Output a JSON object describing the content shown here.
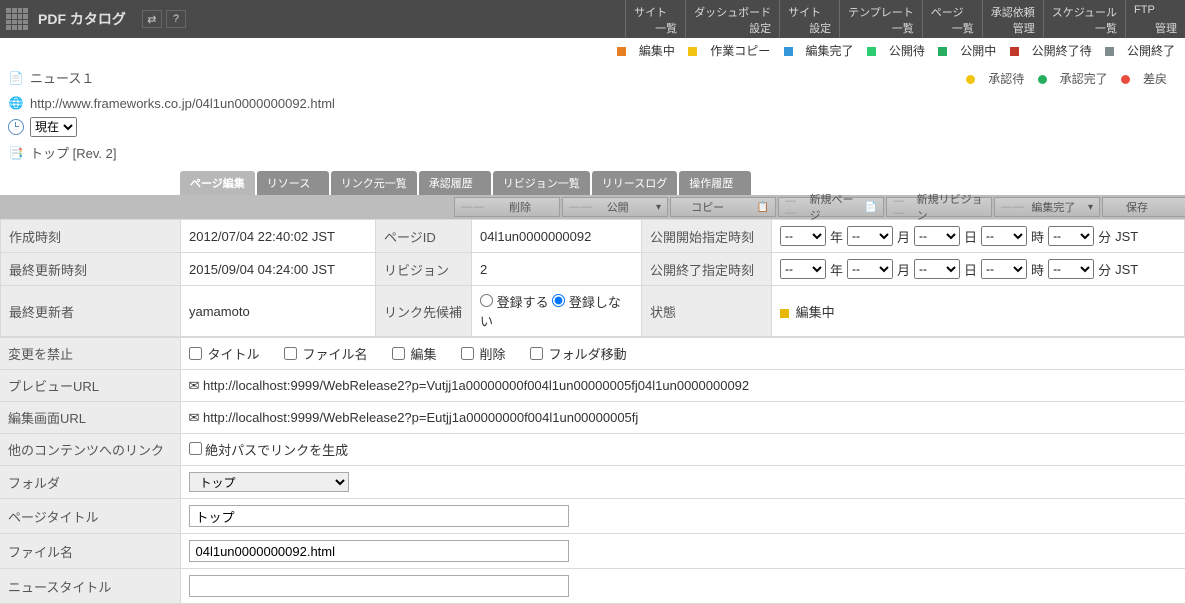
{
  "topbar": {
    "title": "PDF カタログ",
    "nav": [
      {
        "top": "サイト",
        "bottom": "一覧"
      },
      {
        "top": "ダッシュボード",
        "bottom": "設定"
      },
      {
        "top": "サイト",
        "bottom": "設定"
      },
      {
        "top": "テンプレート",
        "bottom": "一覧"
      },
      {
        "top": "ページ",
        "bottom": "一覧"
      },
      {
        "top": "承認依頼",
        "bottom": "管理"
      },
      {
        "top": "スケジュール",
        "bottom": "一覧"
      },
      {
        "top": "FTP",
        "bottom": "管理"
      }
    ]
  },
  "legend1": [
    {
      "color": "#e67e22",
      "label": "編集中"
    },
    {
      "color": "#f1c40f",
      "label": "作業コピー"
    },
    {
      "color": "#3498db",
      "label": "編集完了"
    },
    {
      "color": "#2ecc71",
      "label": "公開待"
    },
    {
      "color": "#27ae60",
      "label": "公開中"
    },
    {
      "color": "#c0392b",
      "label": "公開終了待"
    },
    {
      "color": "#7f8c8d",
      "label": "公開終了"
    }
  ],
  "legend2": [
    {
      "color": "#f1c40f",
      "label": "承認待"
    },
    {
      "color": "#27ae60",
      "label": "承認完了"
    },
    {
      "color": "#e74c3c",
      "label": "差戻"
    }
  ],
  "meta": {
    "page_name": "ニュース１",
    "url": "http://www.frameworks.co.jp/04l1un0000000092.html",
    "time_select": "現在",
    "rev": "トップ [Rev. 2]"
  },
  "tabs": [
    "ページ編集",
    "リソース",
    "リンク元一覧",
    "承認履歴",
    "リビジョン一覧",
    "リリースログ",
    "操作履歴"
  ],
  "actions": {
    "delete": "削除",
    "publish": "公開",
    "copy": "コピー",
    "newpage": "新規ページ",
    "newrev": "新規リビジョン",
    "editdone": "編集完了",
    "save": "保存"
  },
  "info": {
    "created_label": "作成時刻",
    "created": "2012/07/04 22:40:02 JST",
    "updated_label": "最終更新時刻",
    "updated": "2015/09/04 04:24:00 JST",
    "updater_label": "最終更新者",
    "updater": "yamamoto",
    "pageid_label": "ページID",
    "pageid": "04l1un0000000092",
    "revision_label": "リビジョン",
    "revision": "2",
    "linkcand_label": "リンク先候補",
    "linkcand_yes": "登録する",
    "linkcand_no": "登録しない",
    "pubstart_label": "公開開始指定時刻",
    "pubend_label": "公開終了指定時刻",
    "state_label": "状態",
    "state": "編集中",
    "datetime_units": {
      "year": "年",
      "month": "月",
      "day": "日",
      "hour": "時",
      "minute": "分",
      "tz": "JST",
      "dash": "--"
    }
  },
  "form": {
    "lock_label": "変更を禁止",
    "lock_opts": [
      "タイトル",
      "ファイル名",
      "編集",
      "削除",
      "フォルダ移動"
    ],
    "preview_label": "プレビューURL",
    "preview": "http://localhost:9999/WebRelease2?p=Vutjj1a00000000f004l1un00000005fj04l1un0000000092",
    "editurl_label": "編集画面URL",
    "editurl": "http://localhost:9999/WebRelease2?p=Eutjj1a00000000f004l1un00000005fj",
    "otherlink_label": "他のコンテンツへのリンク",
    "otherlink_opt": "絶対パスでリンクを生成",
    "folder_label": "フォルダ",
    "folder": "トップ",
    "pagetitle_label": "ページタイトル",
    "pagetitle": "トップ",
    "filename_label": "ファイル名",
    "filename": "04l1un0000000092.html",
    "newstitle_label": "ニュースタイトル",
    "newstitle": ""
  }
}
